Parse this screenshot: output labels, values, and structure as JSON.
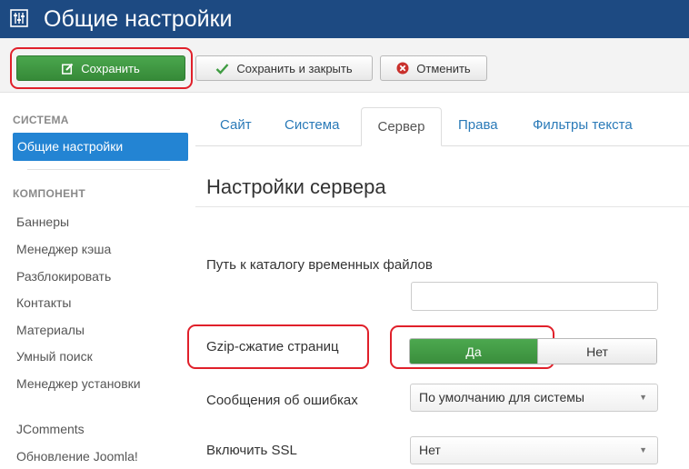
{
  "header": {
    "title": "Общие настройки",
    "icon": "sliders-icon",
    "bg_color": "#1d4a82"
  },
  "toolbar": {
    "save_label": "Сохранить",
    "save_close_label": "Сохранить и закрыть",
    "cancel_label": "Отменить",
    "save_color": "#3f9c42",
    "cancel_icon_color": "#c9302c"
  },
  "sidebar": {
    "system_heading": "СИСТЕМА",
    "active_item": "Общие настройки",
    "component_heading": "КОМПОНЕНТ",
    "items": [
      "Баннеры",
      "Менеджер кэша",
      "Разблокировать",
      "Контакты",
      "Материалы",
      "Умный поиск",
      "Менеджер установки",
      "JComments",
      "Обновление Joomla!"
    ],
    "active_color": "#2384d3"
  },
  "tabs": {
    "site": "Сайт",
    "system": "Система",
    "server": "Сервер",
    "rights": "Права",
    "filters": "Фильтры текста",
    "active": "Сервер"
  },
  "main": {
    "section_title": "Настройки сервера",
    "temp_path_label": "Путь к каталогу временных файлов",
    "temp_path_value": "",
    "gzip_label": "Gzip-сжатие страниц",
    "gzip_yes": "Да",
    "gzip_no": "Нет",
    "gzip_selected": "Да",
    "errors_label": "Сообщения об ошибках",
    "errors_value": "По умолчанию для системы",
    "ssl_label": "Включить SSL",
    "ssl_value": "Нет"
  },
  "highlight_color": "#e0202a"
}
